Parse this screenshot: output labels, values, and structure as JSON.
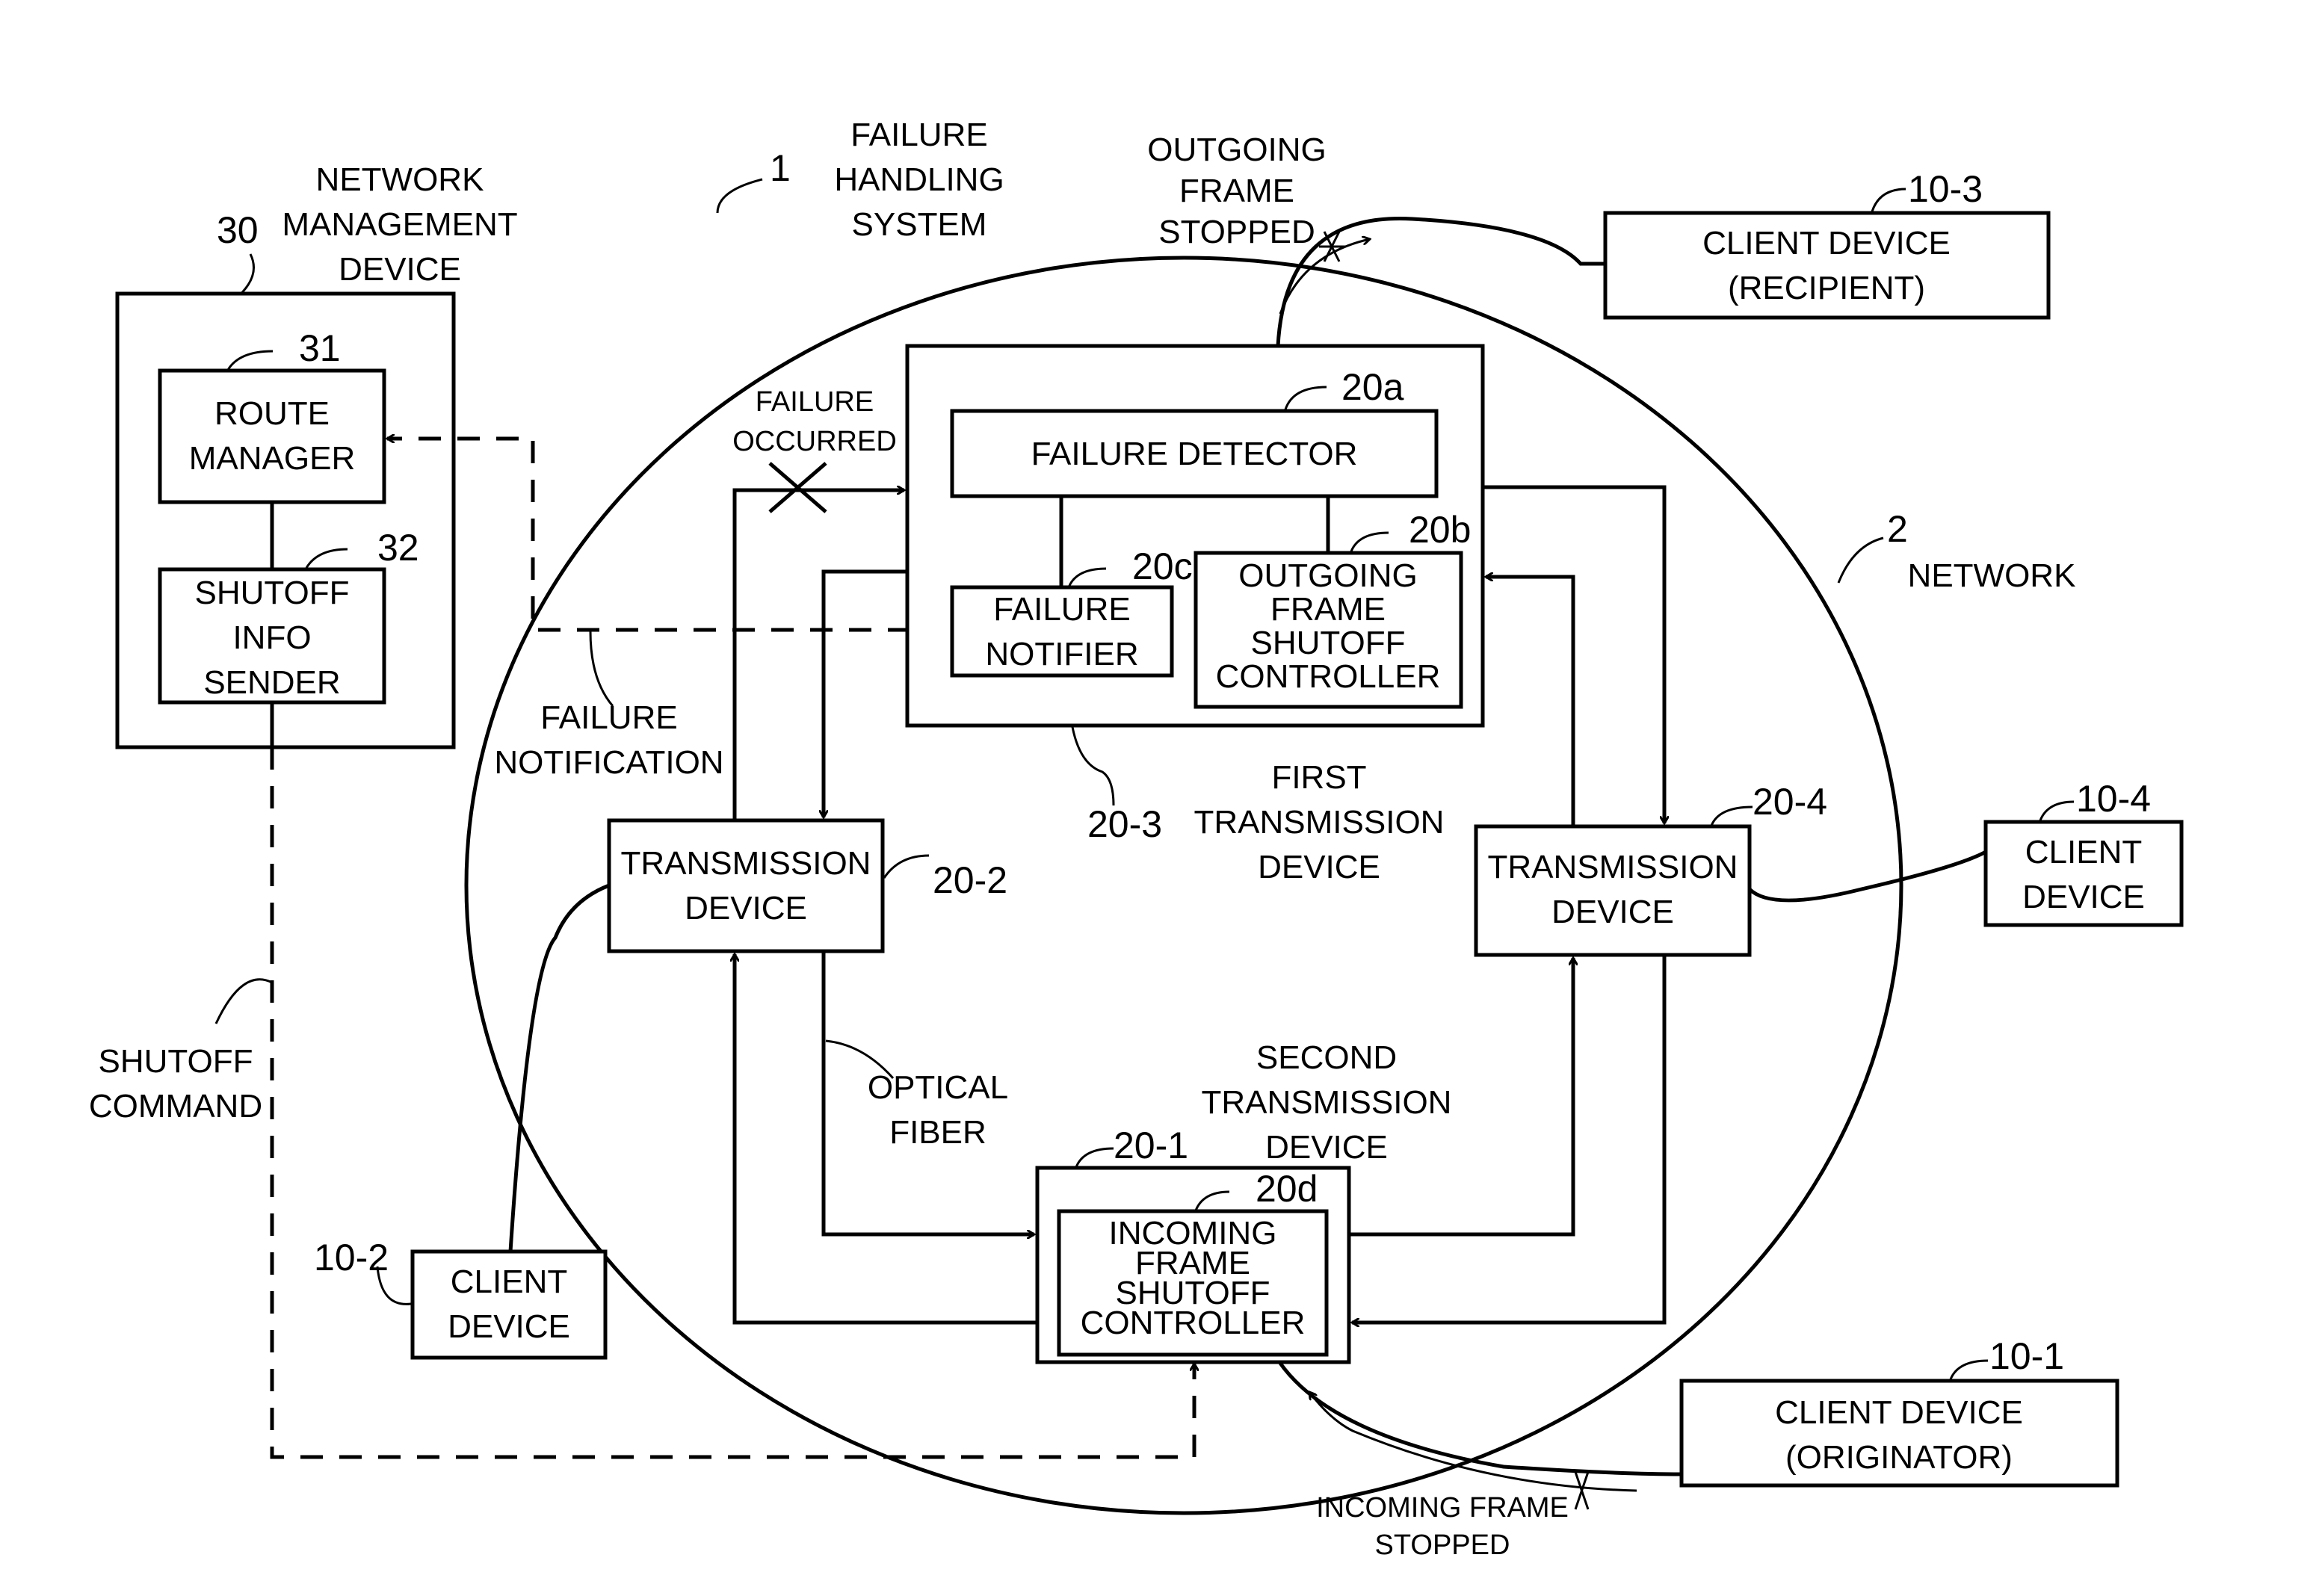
{
  "title": {
    "ref": "1",
    "lines": [
      "FAILURE",
      "HANDLING",
      "SYSTEM"
    ]
  },
  "network": {
    "ref": "2",
    "label": "NETWORK"
  },
  "management": {
    "ref": "30",
    "lines": [
      "NETWORK",
      "MANAGEMENT",
      "DEVICE"
    ],
    "route_manager": {
      "ref": "31",
      "lines": [
        "ROUTE",
        "MANAGER"
      ]
    },
    "shutoff_sender": {
      "ref": "32",
      "lines": [
        "SHUTOFF",
        "INFO",
        "SENDER"
      ]
    }
  },
  "first_device": {
    "ref": "20-3",
    "lines": [
      "FIRST",
      "TRANSMISSION",
      "DEVICE"
    ],
    "detector": {
      "ref": "20a",
      "label": "FAILURE DETECTOR"
    },
    "outgoing_ctrl": {
      "ref": "20b",
      "lines": [
        "OUTGOING",
        "FRAME",
        "SHUTOFF",
        "CONTROLLER"
      ]
    },
    "notifier": {
      "ref": "20c",
      "lines": [
        "FAILURE",
        "NOTIFIER"
      ]
    }
  },
  "second_device": {
    "ref": "20-1",
    "lines": [
      "SECOND",
      "TRANSMISSION",
      "DEVICE"
    ],
    "incoming_ctrl": {
      "ref": "20d",
      "lines": [
        "INCOMING",
        "FRAME",
        "SHUTOFF",
        "CONTROLLER"
      ]
    }
  },
  "tx2": {
    "ref": "20-2",
    "lines": [
      "TRANSMISSION",
      "DEVICE"
    ]
  },
  "tx4": {
    "ref": "20-4",
    "lines": [
      "TRANSMISSION",
      "DEVICE"
    ]
  },
  "clients": {
    "c1": {
      "ref": "10-1",
      "lines": [
        "CLIENT DEVICE",
        "(ORIGINATOR)"
      ]
    },
    "c2": {
      "ref": "10-2",
      "lines": [
        "CLIENT",
        "DEVICE"
      ]
    },
    "c3": {
      "ref": "10-3",
      "lines": [
        "CLIENT DEVICE",
        "(RECIPIENT)"
      ]
    },
    "c4": {
      "ref": "10-4",
      "lines": [
        "CLIENT",
        "DEVICE"
      ]
    }
  },
  "annotations": {
    "failure_occurred": [
      "FAILURE",
      "OCCURRED"
    ],
    "failure_notification": [
      "FAILURE",
      "NOTIFICATION"
    ],
    "shutoff_command": [
      "SHUTOFF",
      "COMMAND"
    ],
    "optical_fiber": [
      "OPTICAL",
      "FIBER"
    ],
    "outgoing_stopped": [
      "OUTGOING",
      "FRAME",
      "STOPPED"
    ],
    "incoming_stopped": [
      "INCOMING FRAME",
      "STOPPED"
    ]
  }
}
